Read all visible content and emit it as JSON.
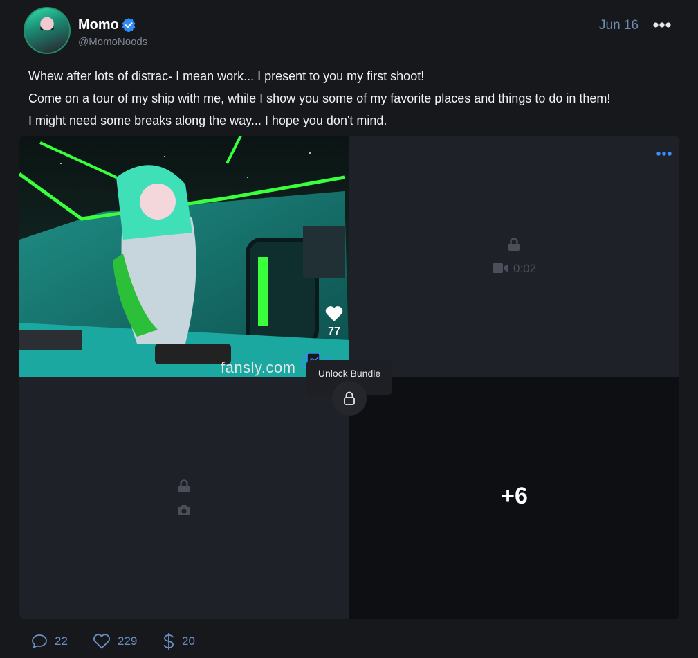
{
  "post": {
    "author_name": "Momo",
    "author_handle": "@MomoNoods",
    "date": "Jun 16",
    "lines": [
      "Whew after lots of distrac- I mean work... I present to you my first shoot!",
      "Come on a tour of my ship with me, while I show you some of my favorite places and things to do in them!",
      "I might need some breaks along the way... I hope you don't mind."
    ]
  },
  "media": {
    "likes": "77",
    "watermark": "fansly.com",
    "bundle_count": "9",
    "tooltip": "Unlock Bundle",
    "video_duration": "0:02",
    "more_count": "+6"
  },
  "actions": {
    "comments": "22",
    "likes": "229",
    "tips": "20"
  },
  "colors": {
    "accent": "#3a8cff",
    "background": "#17181c",
    "action_blue": "#6c8fc4"
  },
  "icons": [
    "verified-badge-icon",
    "more-dots-icon",
    "heart-icon",
    "bundle-icon",
    "lock-icon",
    "video-icon",
    "camera-icon",
    "comment-icon",
    "dollar-icon"
  ]
}
